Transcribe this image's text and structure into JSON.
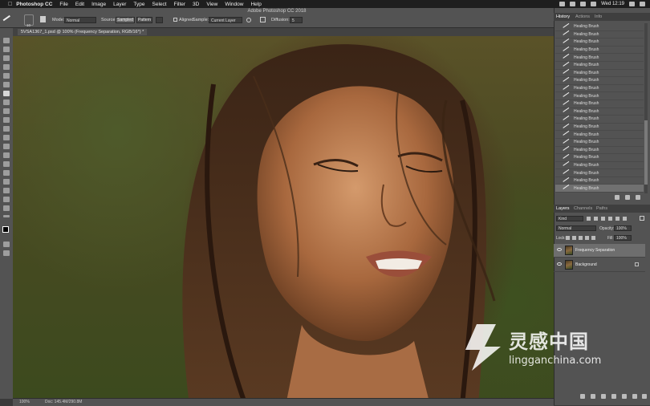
{
  "menubar": {
    "app": "Photoshop CC",
    "items": [
      "File",
      "Edit",
      "Image",
      "Layer",
      "Type",
      "Select",
      "Filter",
      "3D",
      "View",
      "Window",
      "Help"
    ],
    "clock": "Wed 12:19"
  },
  "window_title": "Adobe Photoshop CC 2018",
  "options": {
    "mode_label": "Mode:",
    "mode_value": "Normal",
    "source_label": "Source:",
    "sampled_label": "Sampled",
    "pattern_label": "Pattern",
    "aligned_label": "Aligned",
    "sample_label": "Sample:",
    "sample_value": "Current Layer",
    "diffusion_label": "Diffusion:",
    "diffusion_value": "5",
    "brush_size": "10"
  },
  "document": {
    "tab_title": "5VSA1367_1.psd @ 100% (Frequency Separation, RGB/16*) *"
  },
  "status": {
    "zoom": "100%",
    "doc": "Doc: 145.4M/290.8M"
  },
  "history_panel": {
    "tabs": [
      "History",
      "Actions",
      "Info"
    ],
    "items": [
      "Healing Brush",
      "Healing Brush",
      "Healing Brush",
      "Healing Brush",
      "Healing Brush",
      "Healing Brush",
      "Healing Brush",
      "Healing Brush",
      "Healing Brush",
      "Healing Brush",
      "Healing Brush",
      "Healing Brush",
      "Healing Brush",
      "Healing Brush",
      "Healing Brush",
      "Healing Brush",
      "Healing Brush",
      "Healing Brush",
      "Healing Brush",
      "Healing Brush",
      "Healing Brush",
      "Healing Brush"
    ]
  },
  "layers_panel": {
    "tabs": [
      "Layers",
      "Channels",
      "Paths"
    ],
    "kind_value": "Kind",
    "blend_value": "Normal",
    "opacity_label": "Opacity:",
    "opacity_value": "100%",
    "lock_label": "Lock:",
    "fill_label": "Fill:",
    "fill_value": "100%",
    "layers": [
      {
        "name": "Frequency Separation",
        "selected": true
      },
      {
        "name": "Background",
        "selected": false
      }
    ]
  },
  "watermark": {
    "title": "灵感中国",
    "url": "lingganchina.com"
  },
  "icons": [
    "apple-icon",
    "wifi-icon",
    "search-icon",
    "eye-icon",
    "lock-icon",
    "new-layer-icon",
    "trash-icon",
    "healing-brush-icon"
  ]
}
